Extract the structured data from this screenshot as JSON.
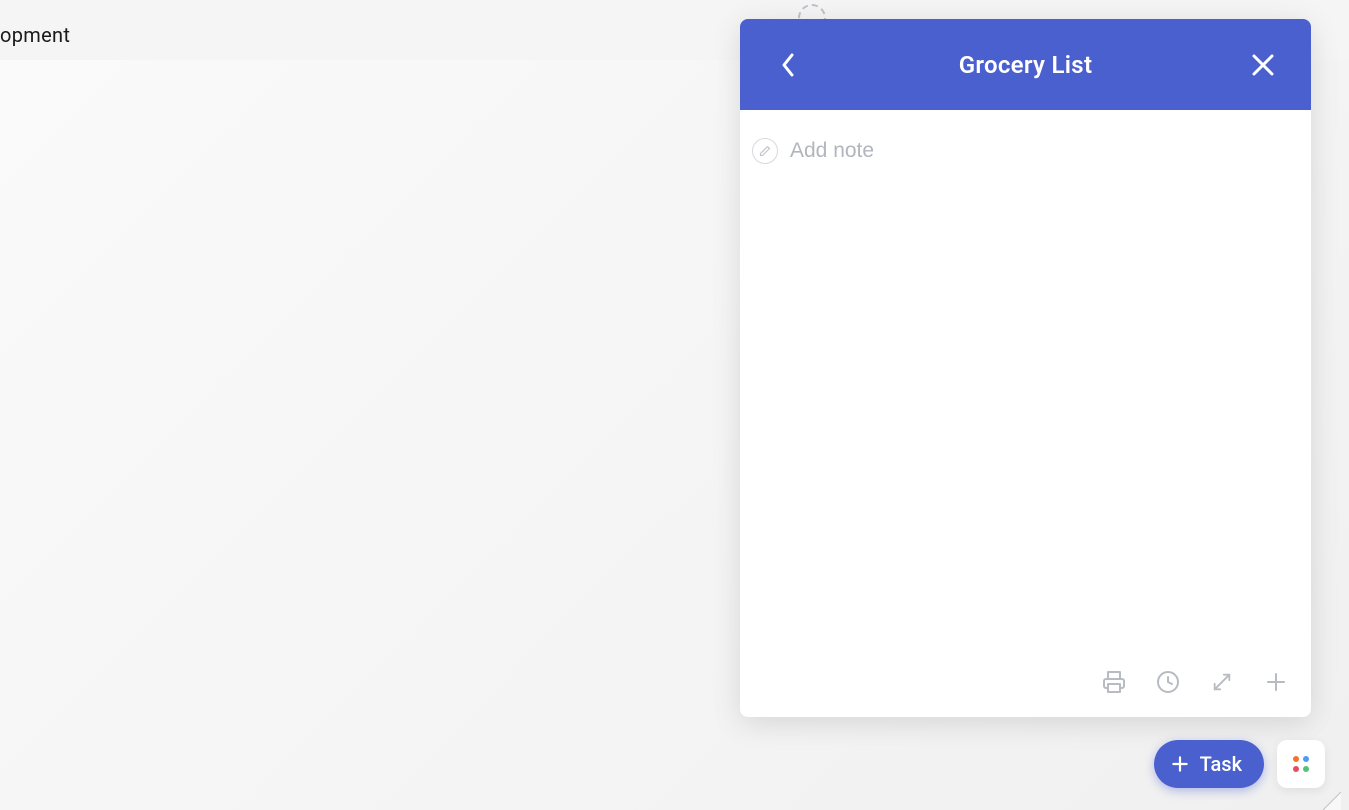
{
  "background": {
    "truncated_text": "opment"
  },
  "panel": {
    "header": {
      "title": "Grocery List"
    },
    "body": {
      "add_note_placeholder": "Add note"
    }
  },
  "task_button": {
    "label": "Task"
  }
}
